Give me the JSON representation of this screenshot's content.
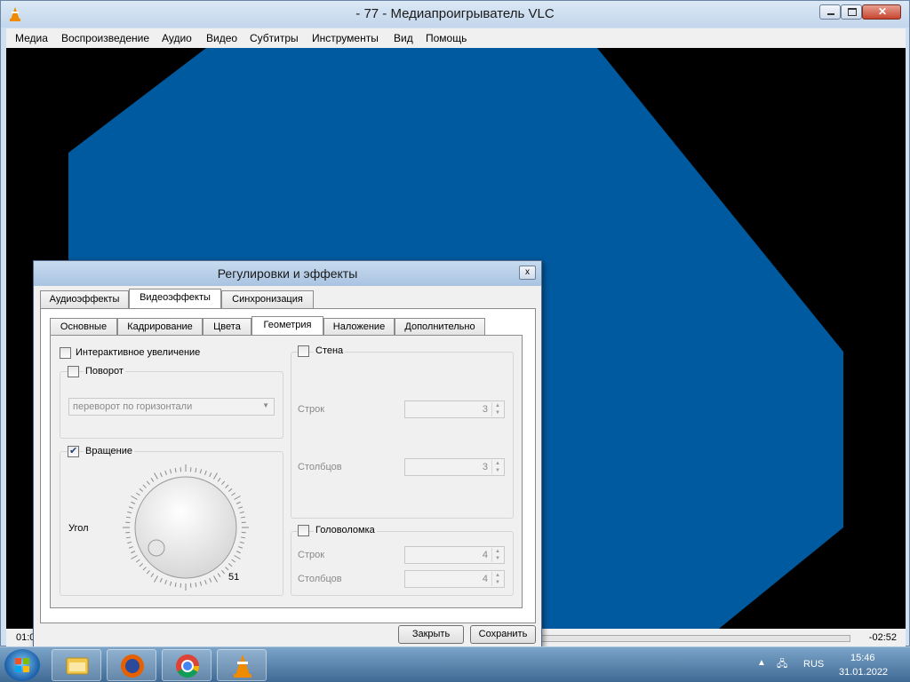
{
  "window": {
    "title": "- 77 - Медиапроигрыватель VLC",
    "menu": [
      "Медиа",
      "Воспроизведение",
      "Аудио",
      "Видео",
      "Субтитры",
      "Инструменты",
      "Вид",
      "Помощь"
    ]
  },
  "player": {
    "time_elapsed": "01:0",
    "time_remaining": "-02:52"
  },
  "dialog": {
    "title": "Регулировки и эффекты",
    "close_label": "x",
    "main_tabs": [
      "Аудиоэффекты",
      "Видеоэффекты",
      "Синхронизация"
    ],
    "main_tab_active": "Видеоэффекты",
    "sub_tabs": [
      "Основные",
      "Кадрирование",
      "Цвета",
      "Геометрия",
      "Наложение",
      "Дополнительно"
    ],
    "sub_tab_active": "Геометрия",
    "interactive_zoom": {
      "label": "Интерактивное увеличение",
      "checked": false
    },
    "rotate": {
      "label": "Поворот",
      "checked": false,
      "select_value": "переворот по горизонтали"
    },
    "rotation": {
      "label": "Вращение",
      "checked": true,
      "angle_label": "Угол",
      "angle_value": "51"
    },
    "wall": {
      "label": "Стена",
      "checked": false,
      "rows_label": "Строк",
      "rows_value": "3",
      "cols_label": "Столбцов",
      "cols_value": "3"
    },
    "puzzle": {
      "label": "Головоломка",
      "checked": false,
      "rows_label": "Строк",
      "rows_value": "4",
      "cols_label": "Столбцов",
      "cols_value": "4"
    },
    "buttons": {
      "close": "Закрыть",
      "save": "Сохранить"
    }
  },
  "taskbar": {
    "language": "RUS",
    "time": "15:46",
    "date": "31.01.2022",
    "apps": [
      "explorer-icon",
      "firefox-icon",
      "chrome-icon",
      "vlc-icon"
    ]
  },
  "colors": {
    "video_shape": "#005aa0",
    "video_bg": "#000000",
    "titlebar": "#c3d6ec"
  }
}
